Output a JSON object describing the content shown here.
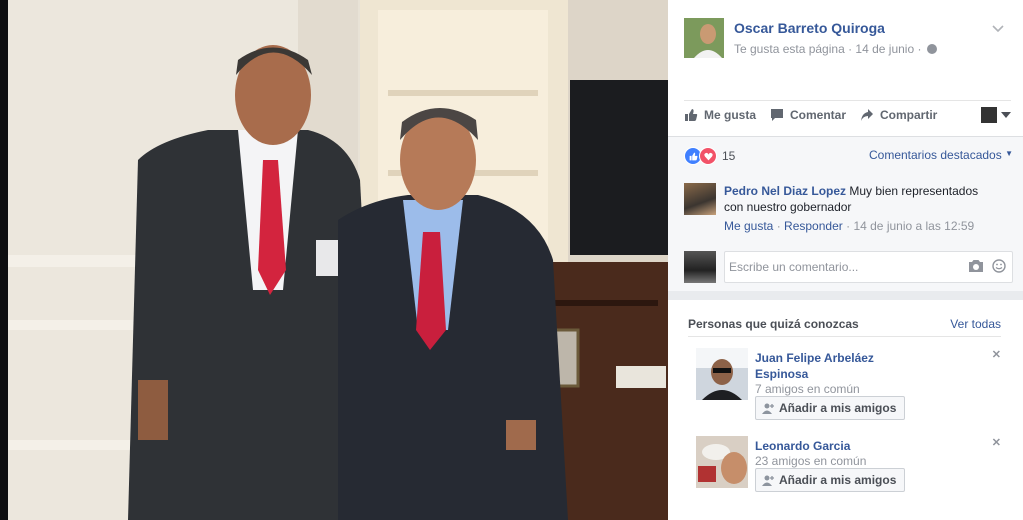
{
  "post": {
    "page_name": "Oscar Barreto Quiroga",
    "meta": "Te gusta esta página · 14 de junio ·",
    "visibility_icon": "globe-icon",
    "menu_icon": "chevron-down-icon"
  },
  "actions": {
    "like": "Me gusta",
    "comment": "Comentar",
    "share": "Compartir"
  },
  "reactions": {
    "count": "15",
    "featured": "Comentarios destacados"
  },
  "comment": {
    "author": "Pedro Nel Diaz Lopez",
    "text": "Muy bien representados con nuestro gobernador",
    "like": "Me gusta",
    "reply": "Responder",
    "time": "14 de junio a las 12:59",
    "sep": "·"
  },
  "composer": {
    "placeholder": "Escribe un comentario..."
  },
  "pymk": {
    "title": "Personas que quizá conozcas",
    "see_all": "Ver todas",
    "people": [
      {
        "name": "Juan Felipe Arbeláez Espinosa",
        "mutual": "7 amigos en común",
        "button": "Añadir a mis amigos"
      },
      {
        "name": "Leonardo Garcia",
        "mutual": "23 amigos en común",
        "button": "Añadir a mis amigos"
      }
    ]
  },
  "colors": {
    "link": "#365899",
    "meta": "#90949c",
    "like": "#4080ff",
    "love": "#f25268"
  }
}
